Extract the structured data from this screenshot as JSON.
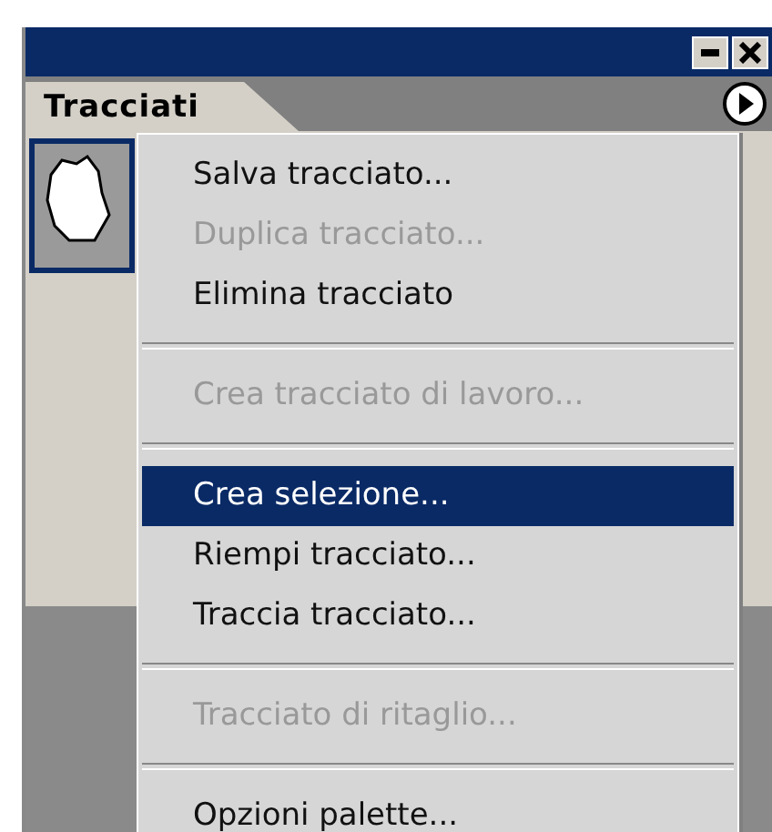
{
  "panel": {
    "tab": {
      "label": "Tracciati",
      "selected": true
    }
  },
  "menu": {
    "items": [
      {
        "kind": "item",
        "label": "Salva tracciato...",
        "disabled": false,
        "selected": false
      },
      {
        "kind": "item",
        "label": "Duplica tracciato...",
        "disabled": true,
        "selected": false
      },
      {
        "kind": "item",
        "label": "Elimina tracciato",
        "disabled": false,
        "selected": false
      },
      {
        "kind": "separator"
      },
      {
        "kind": "item",
        "label": "Crea tracciato di lavoro...",
        "disabled": true,
        "selected": false
      },
      {
        "kind": "separator"
      },
      {
        "kind": "item",
        "label": "Crea selezione...",
        "disabled": false,
        "selected": true
      },
      {
        "kind": "item",
        "label": "Riempi tracciato...",
        "disabled": false,
        "selected": false
      },
      {
        "kind": "item",
        "label": "Traccia tracciato...",
        "disabled": false,
        "selected": false
      },
      {
        "kind": "separator"
      },
      {
        "kind": "item",
        "label": "Tracciato di ritaglio...",
        "disabled": true,
        "selected": false
      },
      {
        "kind": "separator"
      },
      {
        "kind": "item",
        "label": "Opzioni palette...",
        "disabled": false,
        "selected": false
      }
    ]
  }
}
